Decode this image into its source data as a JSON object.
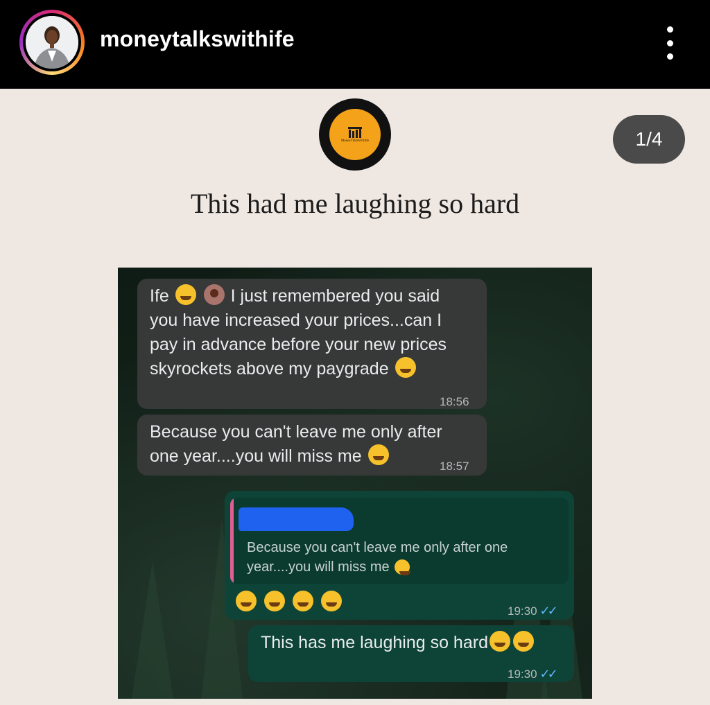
{
  "header": {
    "username": "moneytalkswithife",
    "avatar_icon": "profile-photo",
    "more_icon": "vertical-dots-icon"
  },
  "post": {
    "brand_logo_text": "MoneyTalksWithIfe",
    "counter": "1/4",
    "headline": "This had me laughing so hard"
  },
  "messages": [
    {
      "direction": "incoming",
      "lines": [
        "Ife",
        "I just remembered you said",
        "you have increased your prices...can I",
        "pay in advance before your new prices",
        "skyrockets above my paygrade"
      ],
      "time": "18:56"
    },
    {
      "direction": "incoming",
      "lines": [
        "Because you can't leave me only after",
        "one year....you will miss me"
      ],
      "time": "18:57"
    },
    {
      "direction": "outgoing",
      "quoted_lines": [
        "Because you can't leave me only after one",
        "year....you will miss me"
      ],
      "time": "19:30",
      "emojis": [
        "rofl",
        "rofl",
        "rofl",
        "rofl"
      ]
    },
    {
      "direction": "outgoing",
      "text": "This has me laughing so hard",
      "time": "19:30",
      "emojis": [
        "joy",
        "joy"
      ]
    }
  ],
  "colors": {
    "bar": "#000000",
    "page_bg": "#efe7e2",
    "incoming_bubble": "#373838",
    "outgoing_bubble": "#0e4437",
    "read_ticks": "#5fb7ff",
    "logo_orange": "#f5a21b",
    "redaction_blue": "#1f62f0"
  },
  "read_receipt": "✓✓"
}
